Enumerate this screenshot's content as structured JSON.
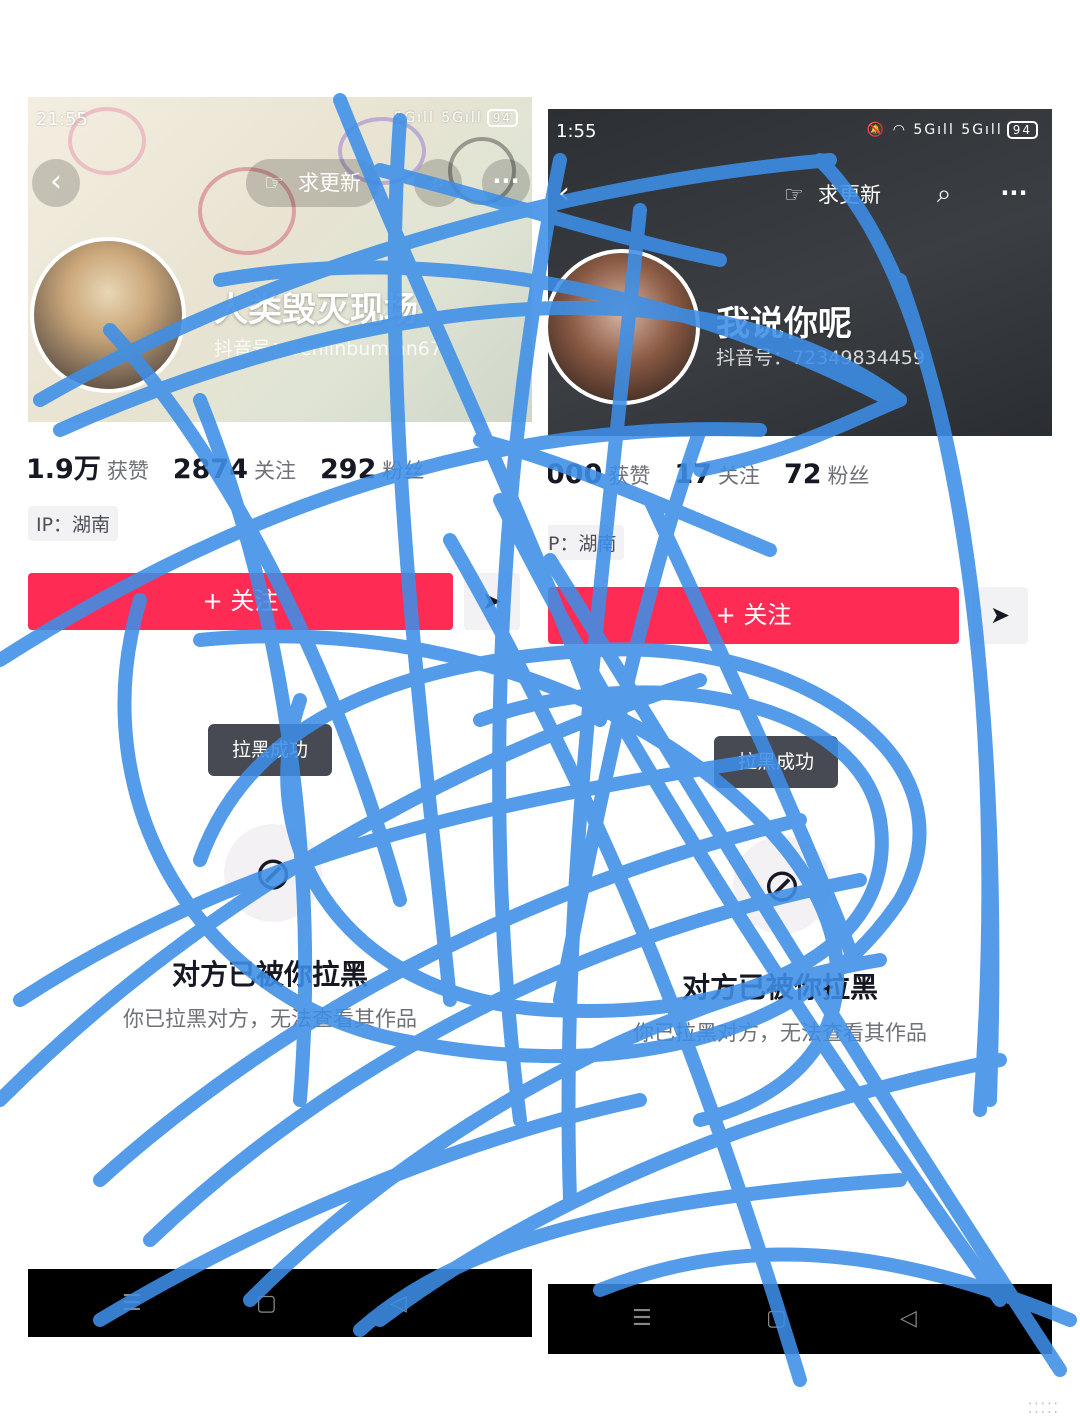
{
  "phones": [
    {
      "status": {
        "time": "21:55",
        "signal": "5Gıll 5Gıll",
        "battery": "94"
      },
      "nav": {
        "back_icon": "chevron-left-icon",
        "update_label": "求更新",
        "update_icon": "hand-pointer-icon",
        "search_icon": "search-icon",
        "more_icon": "more-dots-icon"
      },
      "profile": {
        "nickname": "人类毁灭现场",
        "douyin_id": "抖音号：senlinbumian67"
      },
      "stats": {
        "likes_value": "1.9万",
        "likes_label": "获赞",
        "following_value": "2874",
        "following_label": "关注",
        "followers_value": "292",
        "followers_label": "粉丝"
      },
      "ip": "IP：湖南",
      "follow_label": "+ 关注",
      "share_icon": "send-icon",
      "toast": "拉黑成功",
      "blocked": {
        "title": "对方已被你拉黑",
        "subtitle": "你已拉黑对方，无法查看其作品"
      },
      "sysnav": {
        "menu": "☰",
        "home": "▢",
        "back": "◁"
      }
    },
    {
      "status": {
        "time": "1:55",
        "signal": "🔕 ◠ 5Gıll 5Gıll",
        "battery": "94"
      },
      "nav": {
        "back_icon": "chevron-left-icon",
        "update_label": "求更新",
        "update_icon": "hand-pointer-icon",
        "search_icon": "search-icon",
        "more_icon": "more-dots-icon"
      },
      "profile": {
        "nickname": "我说你呢",
        "douyin_id": "抖音号：72349834459"
      },
      "stats": {
        "likes_value": "000",
        "likes_label": "获赞",
        "following_value": "17",
        "following_label": "关注",
        "followers_value": "72",
        "followers_label": "粉丝"
      },
      "ip": "P：湖南",
      "follow_label": "+ 关注",
      "share_icon": "send-icon",
      "toast": "拉黑成功",
      "blocked": {
        "title": "对方已被你拉黑",
        "subtitle": "你已拉黑对方，无法查看其作品"
      },
      "sysnav": {
        "menu": "☰",
        "home": "▢",
        "back": "◁"
      }
    }
  ],
  "colors": {
    "follow_button": "#fe2c55",
    "scribble": "#3d8fe8",
    "toast": "#474a52"
  }
}
